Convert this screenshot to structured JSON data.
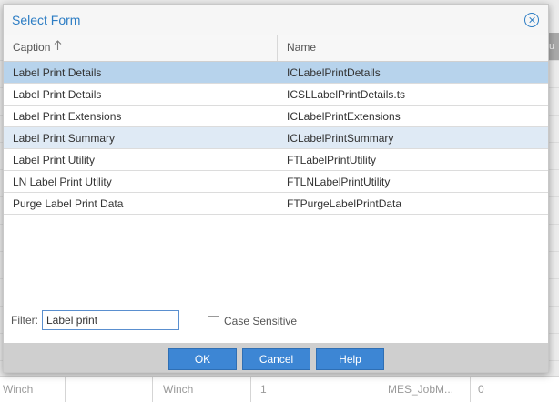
{
  "background": {
    "header_fragment": "tu",
    "row": [
      "Winch",
      "Winch",
      "1",
      "MES_JobM...",
      "0"
    ]
  },
  "dialog": {
    "title": "Select Form",
    "columns": {
      "caption": "Caption",
      "name": "Name"
    },
    "rows": [
      {
        "caption": "Label Print Details",
        "name": "ICLabelPrintDetails"
      },
      {
        "caption": "Label Print Details",
        "name": "ICSLLabelPrintDetails.ts"
      },
      {
        "caption": "Label Print Extensions",
        "name": "ICLabelPrintExtensions"
      },
      {
        "caption": "Label Print Summary",
        "name": "ICLabelPrintSummary"
      },
      {
        "caption": "Label Print Utility",
        "name": "FTLabelPrintUtility"
      },
      {
        "caption": "LN Label Print Utility",
        "name": "FTLNLabelPrintUtility"
      },
      {
        "caption": "Purge Label Print Data",
        "name": "FTPurgeLabelPrintData"
      }
    ],
    "filter": {
      "label": "Filter:",
      "value": "Label print"
    },
    "case_sensitive_label": "Case Sensitive",
    "buttons": {
      "ok": "OK",
      "cancel": "Cancel",
      "help": "Help"
    },
    "colors": {
      "accent": "#2d7dc4",
      "selected_row": "#b7d3ec",
      "alt_row": "#dfeaf5",
      "button": "#3d86d4"
    },
    "icons": {
      "close": "close-circle-icon",
      "sort": "sort-ascending-icon"
    }
  }
}
